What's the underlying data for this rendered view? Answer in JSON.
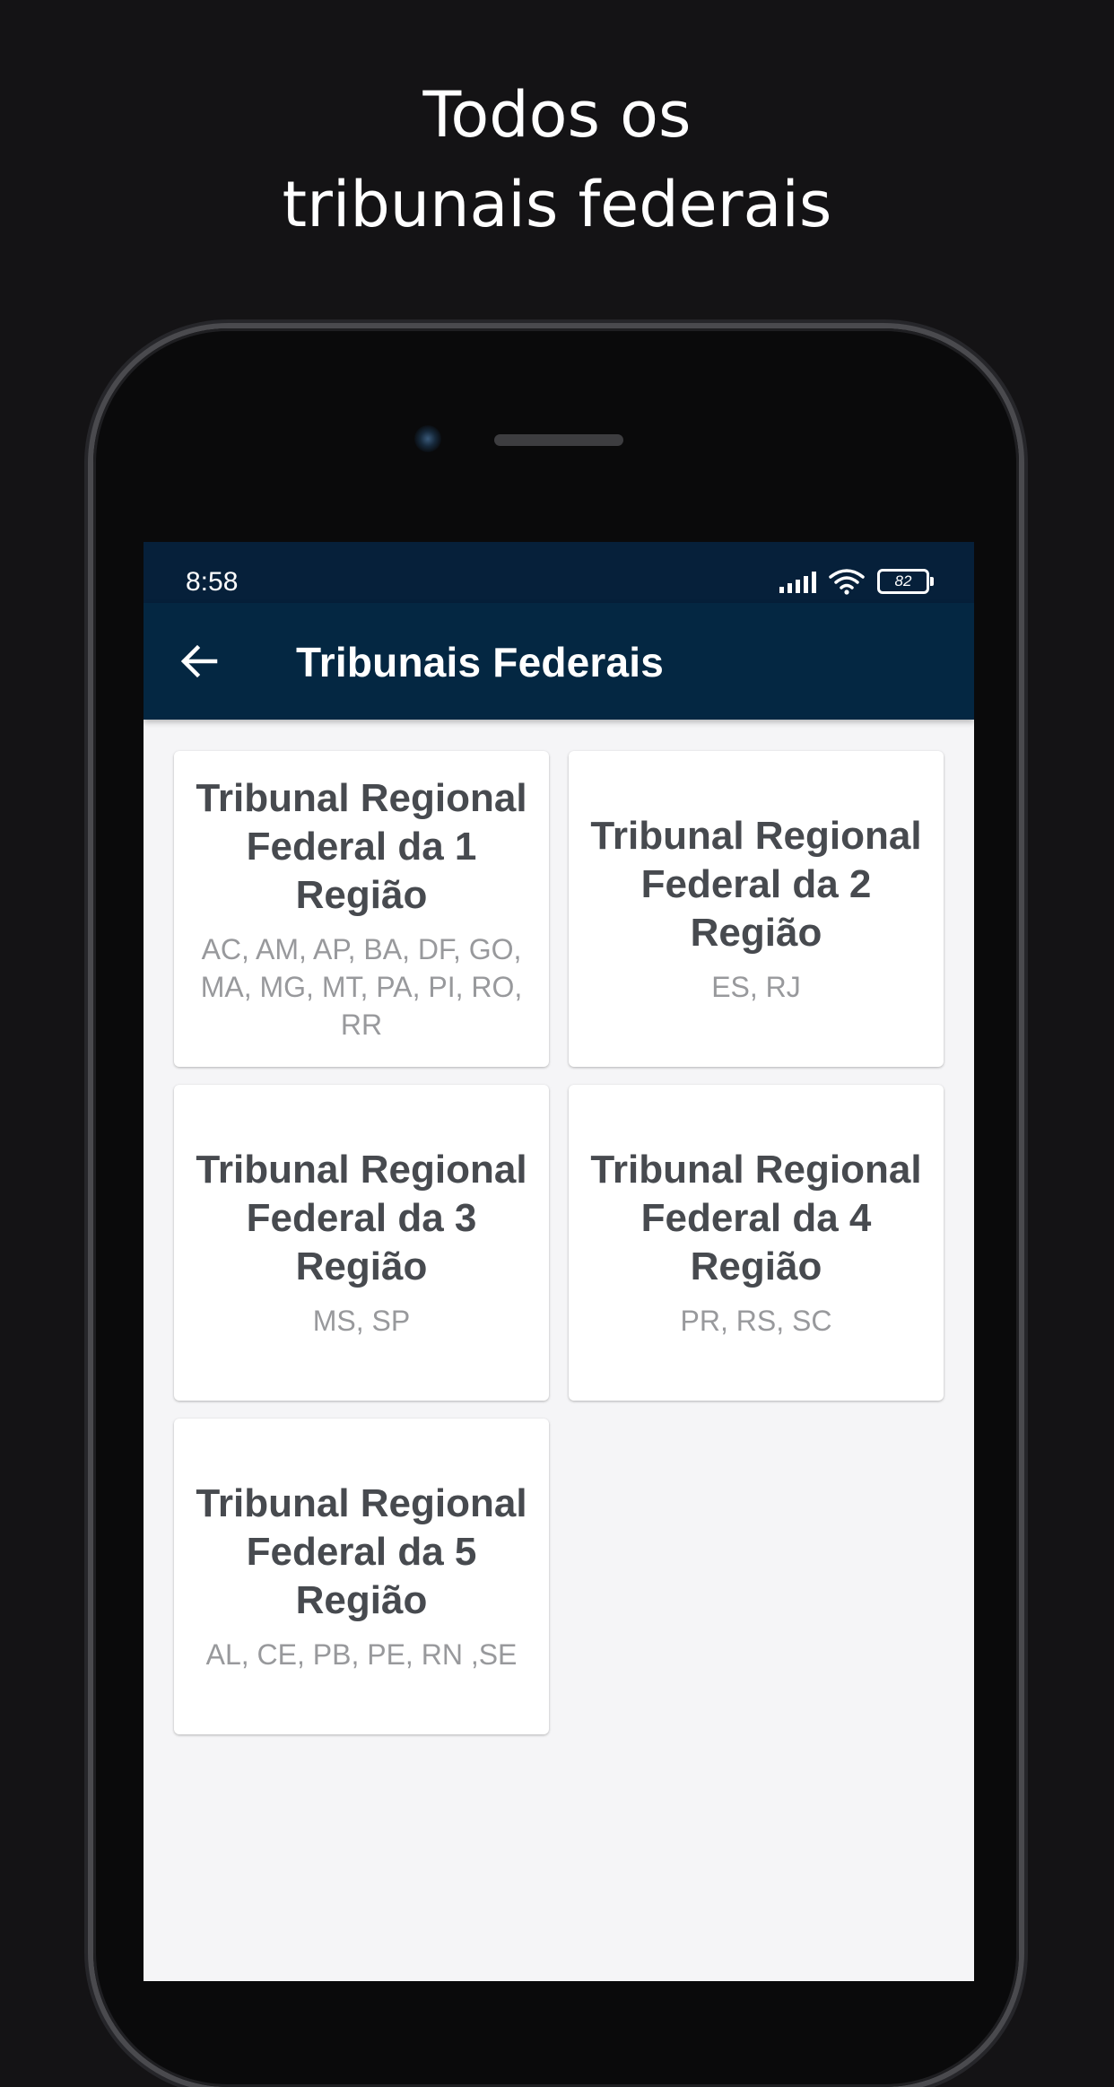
{
  "promo": {
    "line1": "Todos os",
    "line2": "tribunais federais"
  },
  "status_bar": {
    "time": "8:58",
    "battery": "82",
    "icons": [
      "signal-icon",
      "wifi-icon",
      "battery-icon"
    ]
  },
  "app_bar": {
    "back_icon": "arrow-left-icon",
    "title": "Tribunais Federais"
  },
  "tribunals": [
    {
      "title": "Tribunal Regional Federal da 1 Região",
      "states": "AC, AM, AP, BA, DF, GO, MA, MG, MT, PA, PI, RO, RR"
    },
    {
      "title": "Tribunal Regional Federal da 2 Região",
      "states": "ES, RJ"
    },
    {
      "title": "Tribunal Regional Federal da 3 Região",
      "states": "MS, SP"
    },
    {
      "title": "Tribunal Regional Federal da 4 Região",
      "states": "PR, RS, SC"
    },
    {
      "title": "Tribunal Regional Federal da 5 Região",
      "states": "AL, CE, PB, PE, RN ,SE"
    }
  ],
  "colors": {
    "app_bar": "#042742",
    "status_bar": "#06203a",
    "background": "#141315",
    "card_title": "#474a4f",
    "card_states": "#98999c"
  }
}
